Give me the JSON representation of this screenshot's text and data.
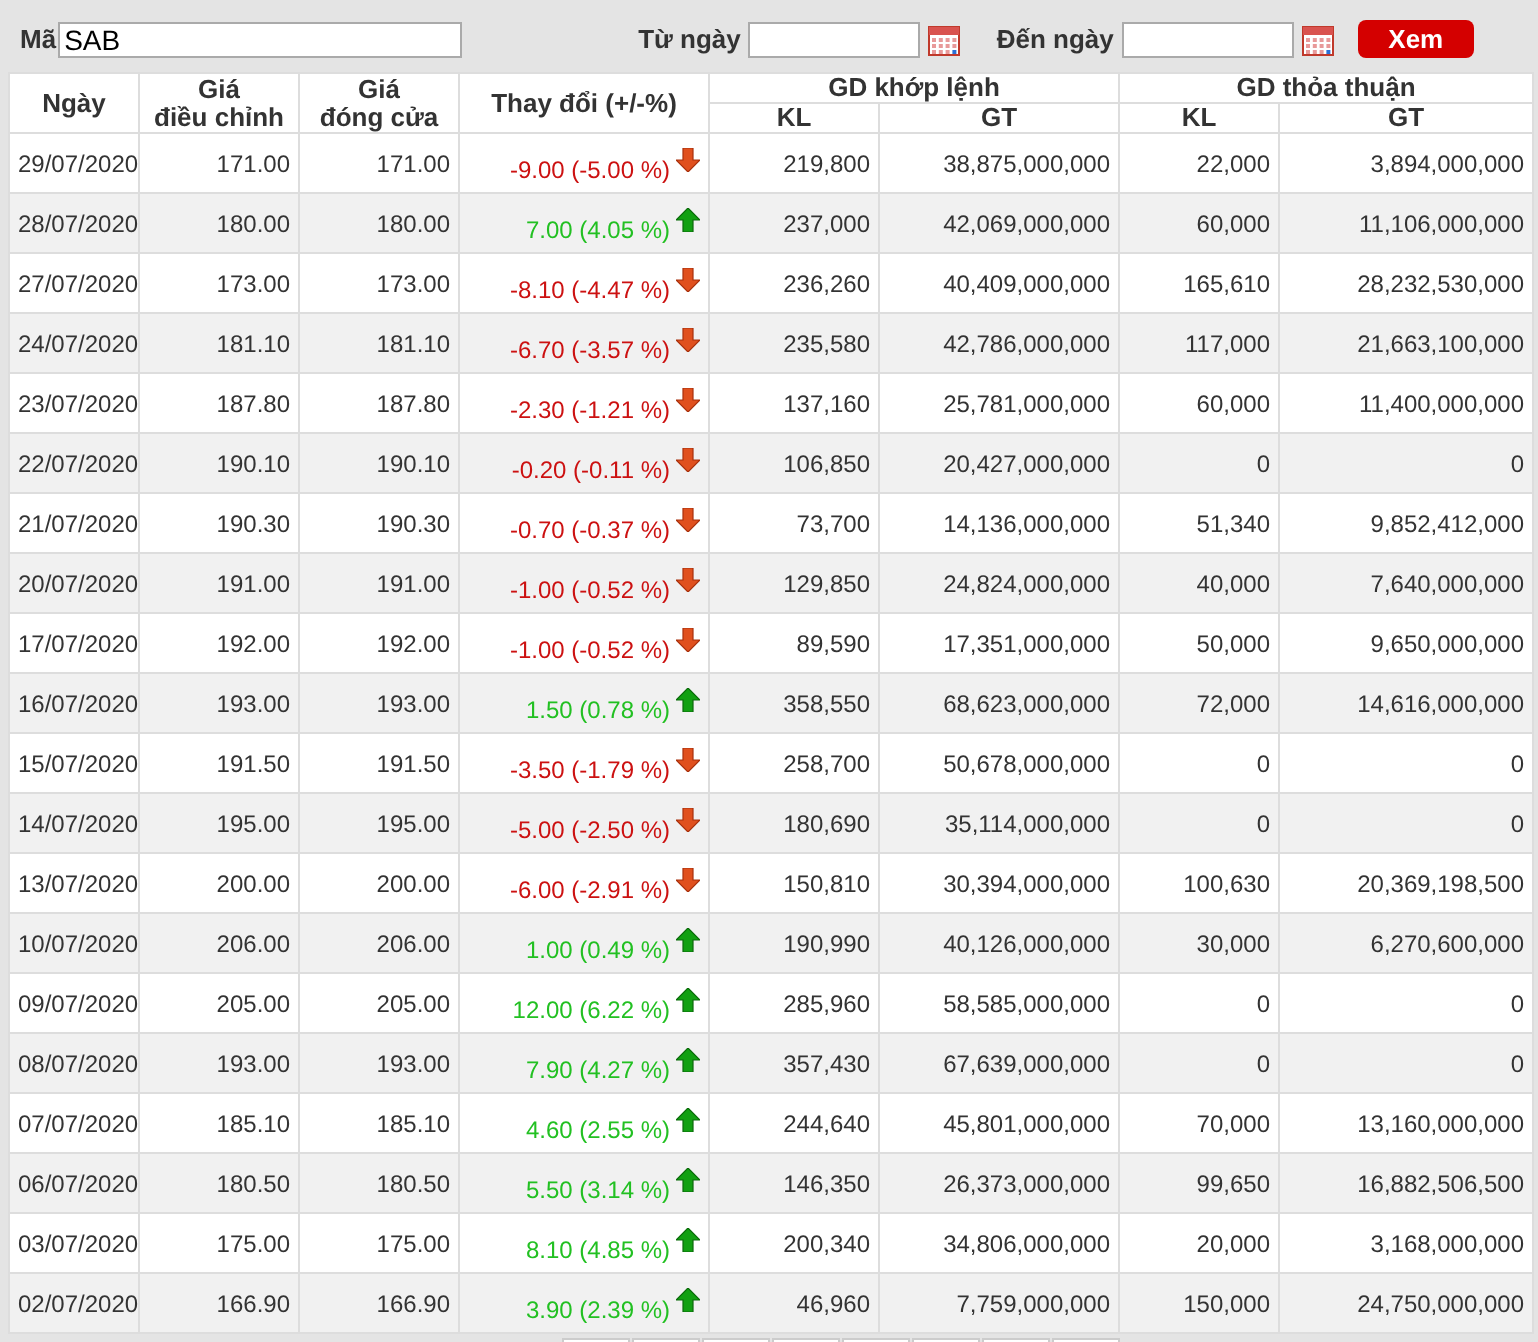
{
  "filter": {
    "symbol_label": "Mã",
    "symbol": "SAB",
    "from_label": "Từ ngày",
    "to_label": "Đến ngày",
    "button": "Xem"
  },
  "table": {
    "columns": [
      {
        "label": "Ngày"
      },
      {
        "label": "Giá\nđiều chỉnh"
      },
      {
        "label": "Giá\nđóng cửa"
      },
      {
        "label": "Thay đổi (+/-%)"
      }
    ],
    "groups": [
      {
        "label": "GD khớp lệnh",
        "columns": [
          "KL",
          "GT"
        ]
      },
      {
        "label": "GD thỏa thuận",
        "columns": [
          "KL",
          "GT"
        ]
      }
    ],
    "rows": [
      {
        "date": "29/07/2020",
        "adjusted": "171.00",
        "close": "171.00",
        "change": "-9.00 (-5.00 %)",
        "rising": false,
        "match_kl": "219,800",
        "match_gt": "38,875,000,000",
        "deal_kl": "22,000",
        "deal_gt": "3,894,000,000"
      },
      {
        "date": "28/07/2020",
        "adjusted": "180.00",
        "close": "180.00",
        "change": "7.00 (4.05 %)",
        "rising": true,
        "match_kl": "237,000",
        "match_gt": "42,069,000,000",
        "deal_kl": "60,000",
        "deal_gt": "11,106,000,000"
      },
      {
        "date": "27/07/2020",
        "adjusted": "173.00",
        "close": "173.00",
        "change": "-8.10 (-4.47 %)",
        "rising": false,
        "match_kl": "236,260",
        "match_gt": "40,409,000,000",
        "deal_kl": "165,610",
        "deal_gt": "28,232,530,000"
      },
      {
        "date": "24/07/2020",
        "adjusted": "181.10",
        "close": "181.10",
        "change": "-6.70 (-3.57 %)",
        "rising": false,
        "match_kl": "235,580",
        "match_gt": "42,786,000,000",
        "deal_kl": "117,000",
        "deal_gt": "21,663,100,000"
      },
      {
        "date": "23/07/2020",
        "adjusted": "187.80",
        "close": "187.80",
        "change": "-2.30 (-1.21 %)",
        "rising": false,
        "match_kl": "137,160",
        "match_gt": "25,781,000,000",
        "deal_kl": "60,000",
        "deal_gt": "11,400,000,000"
      },
      {
        "date": "22/07/2020",
        "adjusted": "190.10",
        "close": "190.10",
        "change": "-0.20 (-0.11 %)",
        "rising": false,
        "match_kl": "106,850",
        "match_gt": "20,427,000,000",
        "deal_kl": "0",
        "deal_gt": "0"
      },
      {
        "date": "21/07/2020",
        "adjusted": "190.30",
        "close": "190.30",
        "change": "-0.70 (-0.37 %)",
        "rising": false,
        "match_kl": "73,700",
        "match_gt": "14,136,000,000",
        "deal_kl": "51,340",
        "deal_gt": "9,852,412,000"
      },
      {
        "date": "20/07/2020",
        "adjusted": "191.00",
        "close": "191.00",
        "change": "-1.00 (-0.52 %)",
        "rising": false,
        "match_kl": "129,850",
        "match_gt": "24,824,000,000",
        "deal_kl": "40,000",
        "deal_gt": "7,640,000,000"
      },
      {
        "date": "17/07/2020",
        "adjusted": "192.00",
        "close": "192.00",
        "change": "-1.00 (-0.52 %)",
        "rising": false,
        "match_kl": "89,590",
        "match_gt": "17,351,000,000",
        "deal_kl": "50,000",
        "deal_gt": "9,650,000,000"
      },
      {
        "date": "16/07/2020",
        "adjusted": "193.00",
        "close": "193.00",
        "change": "1.50 (0.78 %)",
        "rising": true,
        "match_kl": "358,550",
        "match_gt": "68,623,000,000",
        "deal_kl": "72,000",
        "deal_gt": "14,616,000,000"
      },
      {
        "date": "15/07/2020",
        "adjusted": "191.50",
        "close": "191.50",
        "change": "-3.50 (-1.79 %)",
        "rising": false,
        "match_kl": "258,700",
        "match_gt": "50,678,000,000",
        "deal_kl": "0",
        "deal_gt": "0"
      },
      {
        "date": "14/07/2020",
        "adjusted": "195.00",
        "close": "195.00",
        "change": "-5.00 (-2.50 %)",
        "rising": false,
        "match_kl": "180,690",
        "match_gt": "35,114,000,000",
        "deal_kl": "0",
        "deal_gt": "0"
      },
      {
        "date": "13/07/2020",
        "adjusted": "200.00",
        "close": "200.00",
        "change": "-6.00 (-2.91 %)",
        "rising": false,
        "match_kl": "150,810",
        "match_gt": "30,394,000,000",
        "deal_kl": "100,630",
        "deal_gt": "20,369,198,500"
      },
      {
        "date": "10/07/2020",
        "adjusted": "206.00",
        "close": "206.00",
        "change": "1.00 (0.49 %)",
        "rising": true,
        "match_kl": "190,990",
        "match_gt": "40,126,000,000",
        "deal_kl": "30,000",
        "deal_gt": "6,270,600,000"
      },
      {
        "date": "09/07/2020",
        "adjusted": "205.00",
        "close": "205.00",
        "change": "12.00 (6.22 %)",
        "rising": true,
        "match_kl": "285,960",
        "match_gt": "58,585,000,000",
        "deal_kl": "0",
        "deal_gt": "0"
      },
      {
        "date": "08/07/2020",
        "adjusted": "193.00",
        "close": "193.00",
        "change": "7.90 (4.27 %)",
        "rising": true,
        "match_kl": "357,430",
        "match_gt": "67,639,000,000",
        "deal_kl": "0",
        "deal_gt": "0"
      },
      {
        "date": "07/07/2020",
        "adjusted": "185.10",
        "close": "185.10",
        "change": "4.60 (2.55 %)",
        "rising": true,
        "match_kl": "244,640",
        "match_gt": "45,801,000,000",
        "deal_kl": "70,000",
        "deal_gt": "13,160,000,000"
      },
      {
        "date": "06/07/2020",
        "adjusted": "180.50",
        "close": "180.50",
        "change": "5.50 (3.14 %)",
        "rising": true,
        "match_kl": "146,350",
        "match_gt": "26,373,000,000",
        "deal_kl": "99,650",
        "deal_gt": "16,882,506,500"
      },
      {
        "date": "03/07/2020",
        "adjusted": "175.00",
        "close": "175.00",
        "change": "8.10 (4.85 %)",
        "rising": true,
        "match_kl": "200,340",
        "match_gt": "34,806,000,000",
        "deal_kl": "20,000",
        "deal_gt": "3,168,000,000"
      },
      {
        "date": "02/07/2020",
        "adjusted": "166.90",
        "close": "166.90",
        "change": "3.90 (2.39 %)",
        "rising": true,
        "match_kl": "46,960",
        "match_gt": "7,759,000,000",
        "deal_kl": "150,000",
        "deal_gt": "24,750,000,000"
      }
    ]
  }
}
